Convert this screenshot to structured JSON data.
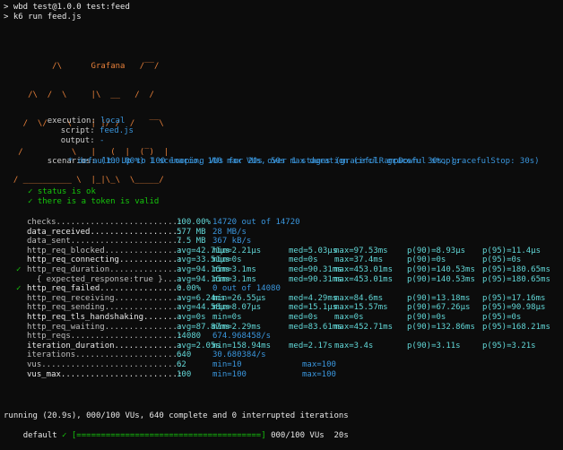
{
  "prompt": {
    "line1": "> wbd test@1.0.0 test:feed",
    "line2": "> k6 run feed.js"
  },
  "logo": {
    "brand": "Grafana",
    "art": [
      "          /\\      Grafana   /‾‾/",
      "     /\\  /  \\     |\\  __   /  /",
      "    /  \\/    \\    | |/ /  /   ‾‾\\",
      "   /          \\   |   (  |  (‾)  |",
      "  / __________ \\  |_|\\_\\  \\_____/"
    ]
  },
  "execution": {
    "execution_label": "execution:",
    "execution_value": "local",
    "script_label": "script:",
    "script_value": "feed.js",
    "output_label": "output:",
    "output_value": "-"
  },
  "scenarios": {
    "label": "scenarios:",
    "summary": "(100.00%) 1 scenario, 100 max VUs, 50s max duration (incl. graceful stop):",
    "detail": "* default: Up to 100 looping VUs for 20s over 1 stages (gracefulRampDown: 30s, gracefulStop: 30s)"
  },
  "checks_list": [
    "✓ status is ok",
    "✓ there is a token is valid"
  ],
  "metrics": [
    {
      "mark": "",
      "name": "checks.........................:",
      "cols": [
        "100.00%",
        "14720 out of 14720"
      ],
      "type": "rate",
      "bold": false
    },
    {
      "mark": "",
      "name": "data_received..................:",
      "cols": [
        "577 MB",
        "28 MB/s"
      ],
      "type": "rate",
      "bold": true
    },
    {
      "mark": "",
      "name": "data_sent......................:",
      "cols": [
        "7.5 MB",
        "367 kB/s"
      ],
      "type": "rate",
      "bold": false
    },
    {
      "mark": "",
      "name": "http_req_blocked...............:",
      "cols": [
        "avg=42.71µs",
        "min=2.21µs",
        "med=5.03µs",
        "max=97.53ms",
        "p(90)=8.93µs",
        "p(95)=11.4µs"
      ],
      "type": "trend",
      "bold": false
    },
    {
      "mark": "",
      "name": "http_req_connecting............:",
      "cols": [
        "avg=33.51µs",
        "min=0s",
        "med=0s",
        "max=37.4ms",
        "p(90)=0s",
        "p(95)=0s"
      ],
      "type": "trend",
      "bold": true
    },
    {
      "mark": "✓",
      "name": "http_req_duration..............:",
      "cols": [
        "avg=94.16ms",
        "min=3.1ms",
        "med=90.31ms",
        "max=453.01ms",
        "p(90)=140.53ms",
        "p(95)=180.65ms"
      ],
      "type": "trend",
      "bold": false
    },
    {
      "mark": "",
      "name": "  { expected_response:true }...:",
      "cols": [
        "avg=94.16ms",
        "min=3.1ms",
        "med=90.31ms",
        "max=453.01ms",
        "p(90)=140.53ms",
        "p(95)=180.65ms"
      ],
      "type": "trend",
      "bold": false,
      "indent": true
    },
    {
      "mark": "✓",
      "name": "http_req_failed................:",
      "cols": [
        "0.00%",
        "0 out of 14080"
      ],
      "type": "rate",
      "bold": true
    },
    {
      "mark": "",
      "name": "http_req_receiving.............:",
      "cols": [
        "avg=6.24ms",
        "min=26.55µs",
        "med=4.29ms",
        "max=84.6ms",
        "p(90)=13.18ms",
        "p(95)=17.16ms"
      ],
      "type": "trend",
      "bold": false
    },
    {
      "mark": "",
      "name": "http_req_sending...............:",
      "cols": [
        "avg=44.58µs",
        "min=8.07µs",
        "med=15.1µs",
        "max=15.57ms",
        "p(90)=67.26µs",
        "p(95)=90.98µs"
      ],
      "type": "trend",
      "bold": false
    },
    {
      "mark": "",
      "name": "http_req_tls_handshaking.......:",
      "cols": [
        "avg=0s",
        "min=0s",
        "med=0s",
        "max=0s",
        "p(90)=0s",
        "p(95)=0s"
      ],
      "type": "trend",
      "bold": true
    },
    {
      "mark": "",
      "name": "http_req_waiting...............:",
      "cols": [
        "avg=87.87ms",
        "min=2.29ms",
        "med=83.61ms",
        "max=452.71ms",
        "p(90)=132.86ms",
        "p(95)=168.21ms"
      ],
      "type": "trend",
      "bold": false
    },
    {
      "mark": "",
      "name": "http_reqs......................:",
      "cols": [
        "14080",
        "674.968458/s"
      ],
      "type": "rate",
      "bold": false
    },
    {
      "mark": "",
      "name": "iteration_duration.............:",
      "cols": [
        "avg=2.05s",
        "min=158.94ms",
        "med=2.17s",
        "max=3.4s",
        "p(90)=3.11s",
        "p(95)=3.21s"
      ],
      "type": "trend",
      "bold": true
    },
    {
      "mark": "",
      "name": "iterations.....................:",
      "cols": [
        "640",
        "30.680384/s"
      ],
      "type": "rate",
      "bold": false
    },
    {
      "mark": "",
      "name": "vus............................:",
      "cols": [
        "62",
        "min=10",
        "max=100"
      ],
      "type": "gauge",
      "bold": false
    },
    {
      "mark": "",
      "name": "vus_max........................:",
      "cols": [
        "100",
        "min=100",
        "max=100"
      ],
      "type": "gauge",
      "bold": true
    }
  ],
  "footer": {
    "running": "running (20.9s), 000/100 VUs, 640 complete and 0 interrupted iterations",
    "default_label": "default",
    "check": "✓",
    "bar": "[======================================]",
    "bar_status": "000/100 VUs  20s",
    "progress": 1.0
  }
}
